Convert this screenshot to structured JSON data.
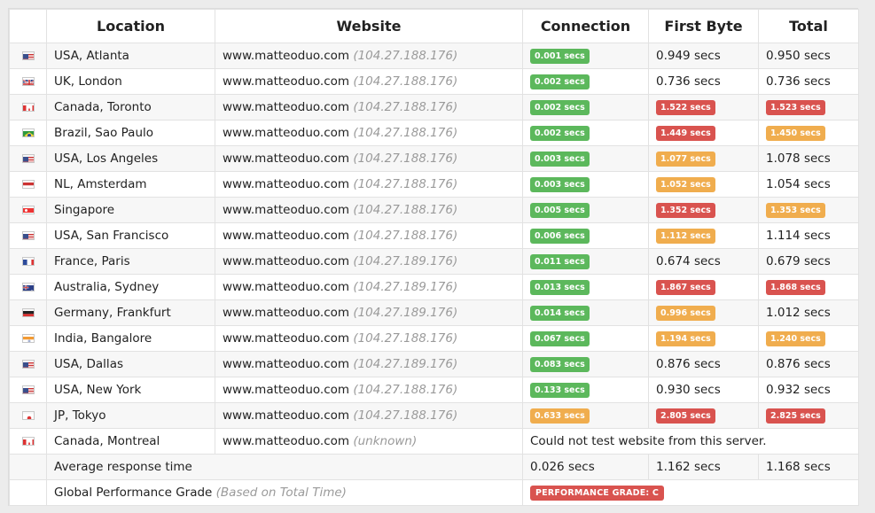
{
  "colors": {
    "good": "#5cb85c",
    "warn": "#f0ad4e",
    "bad": "#d9534f"
  },
  "headers": {
    "location": "Location",
    "website": "Website",
    "connection": "Connection",
    "first_byte": "First Byte",
    "total": "Total"
  },
  "rows": [
    {
      "flag": "us",
      "location": "USA, Atlanta",
      "site": "www.matteoduo.com",
      "ip": "(104.27.188.176)",
      "connection": "0.001 secs",
      "connection_status": "green",
      "first_byte": "0.949 secs",
      "first_byte_status": "plain",
      "total": "0.950 secs",
      "total_status": "plain"
    },
    {
      "flag": "uk",
      "location": "UK, London",
      "site": "www.matteoduo.com",
      "ip": "(104.27.188.176)",
      "connection": "0.002 secs",
      "connection_status": "green",
      "first_byte": "0.736 secs",
      "first_byte_status": "plain",
      "total": "0.736 secs",
      "total_status": "plain"
    },
    {
      "flag": "ca",
      "location": "Canada, Toronto",
      "site": "www.matteoduo.com",
      "ip": "(104.27.188.176)",
      "connection": "0.002 secs",
      "connection_status": "green",
      "first_byte": "1.522 secs",
      "first_byte_status": "red",
      "total": "1.523 secs",
      "total_status": "red"
    },
    {
      "flag": "br",
      "location": "Brazil, Sao Paulo",
      "site": "www.matteoduo.com",
      "ip": "(104.27.188.176)",
      "connection": "0.002 secs",
      "connection_status": "green",
      "first_byte": "1.449 secs",
      "first_byte_status": "red",
      "total": "1.450 secs",
      "total_status": "orange"
    },
    {
      "flag": "us",
      "location": "USA, Los Angeles",
      "site": "www.matteoduo.com",
      "ip": "(104.27.188.176)",
      "connection": "0.003 secs",
      "connection_status": "green",
      "first_byte": "1.077 secs",
      "first_byte_status": "orange",
      "total": "1.078 secs",
      "total_status": "plain"
    },
    {
      "flag": "nl",
      "location": "NL, Amsterdam",
      "site": "www.matteoduo.com",
      "ip": "(104.27.188.176)",
      "connection": "0.003 secs",
      "connection_status": "green",
      "first_byte": "1.052 secs",
      "first_byte_status": "orange",
      "total": "1.054 secs",
      "total_status": "plain"
    },
    {
      "flag": "sg",
      "location": "Singapore",
      "site": "www.matteoduo.com",
      "ip": "(104.27.188.176)",
      "connection": "0.005 secs",
      "connection_status": "green",
      "first_byte": "1.352 secs",
      "first_byte_status": "red",
      "total": "1.353 secs",
      "total_status": "orange"
    },
    {
      "flag": "us",
      "location": "USA, San Francisco",
      "site": "www.matteoduo.com",
      "ip": "(104.27.188.176)",
      "connection": "0.006 secs",
      "connection_status": "green",
      "first_byte": "1.112 secs",
      "first_byte_status": "orange",
      "total": "1.114 secs",
      "total_status": "plain"
    },
    {
      "flag": "fr",
      "location": "France, Paris",
      "site": "www.matteoduo.com",
      "ip": "(104.27.189.176)",
      "connection": "0.011 secs",
      "connection_status": "green",
      "first_byte": "0.674 secs",
      "first_byte_status": "plain",
      "total": "0.679 secs",
      "total_status": "plain"
    },
    {
      "flag": "au",
      "location": "Australia, Sydney",
      "site": "www.matteoduo.com",
      "ip": "(104.27.189.176)",
      "connection": "0.013 secs",
      "connection_status": "green",
      "first_byte": "1.867 secs",
      "first_byte_status": "red",
      "total": "1.868 secs",
      "total_status": "red"
    },
    {
      "flag": "de",
      "location": "Germany, Frankfurt",
      "site": "www.matteoduo.com",
      "ip": "(104.27.189.176)",
      "connection": "0.014 secs",
      "connection_status": "green",
      "first_byte": "0.996 secs",
      "first_byte_status": "orange",
      "total": "1.012 secs",
      "total_status": "plain"
    },
    {
      "flag": "in",
      "location": "India, Bangalore",
      "site": "www.matteoduo.com",
      "ip": "(104.27.188.176)",
      "connection": "0.067 secs",
      "connection_status": "green",
      "first_byte": "1.194 secs",
      "first_byte_status": "orange",
      "total": "1.240 secs",
      "total_status": "orange"
    },
    {
      "flag": "us",
      "location": "USA, Dallas",
      "site": "www.matteoduo.com",
      "ip": "(104.27.189.176)",
      "connection": "0.083 secs",
      "connection_status": "green",
      "first_byte": "0.876 secs",
      "first_byte_status": "plain",
      "total": "0.876 secs",
      "total_status": "plain"
    },
    {
      "flag": "us",
      "location": "USA, New York",
      "site": "www.matteoduo.com",
      "ip": "(104.27.188.176)",
      "connection": "0.133 secs",
      "connection_status": "green",
      "first_byte": "0.930 secs",
      "first_byte_status": "plain",
      "total": "0.932 secs",
      "total_status": "plain"
    },
    {
      "flag": "jp",
      "location": "JP, Tokyo",
      "site": "www.matteoduo.com",
      "ip": "(104.27.188.176)",
      "connection": "0.633 secs",
      "connection_status": "orange",
      "first_byte": "2.805 secs",
      "first_byte_status": "red",
      "total": "2.825 secs",
      "total_status": "red"
    },
    {
      "flag": "ca",
      "location": "Canada, Montreal",
      "site": "www.matteoduo.com",
      "ip": "(unknown)",
      "error": "Could not test website from this server."
    }
  ],
  "average": {
    "label": "Average response time",
    "connection": "0.026 secs",
    "first_byte": "1.162 secs",
    "total": "1.168 secs"
  },
  "grade": {
    "label": "Global Performance Grade",
    "note": "(Based on Total Time)",
    "badge": "PERFORMANCE GRADE:  C"
  }
}
